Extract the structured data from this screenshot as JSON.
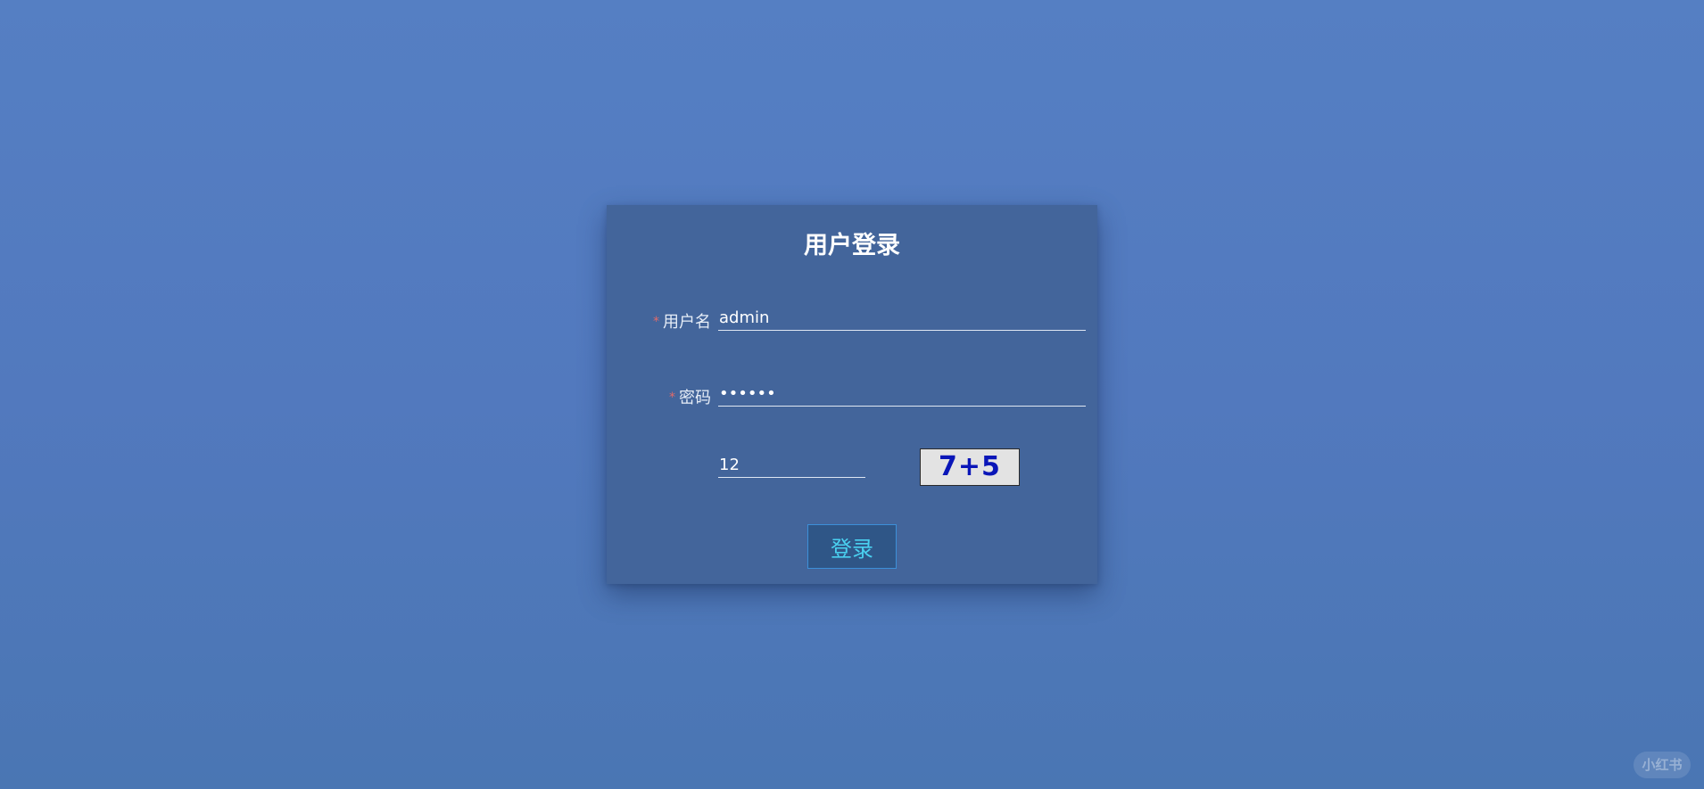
{
  "login": {
    "title": "用户登录",
    "username": {
      "required_mark": "*",
      "label": "用户名",
      "value": "admin"
    },
    "password": {
      "required_mark": "*",
      "label": "密码",
      "value": "••••••"
    },
    "captcha": {
      "input_value": "12",
      "image_text": "7+5"
    },
    "submit_label": "登录"
  },
  "watermark": {
    "text": "小红书"
  },
  "colors": {
    "background": "#557fc3",
    "card": "#43659b",
    "button_text": "#4ad0f0",
    "captcha_text": "#0a16b8",
    "required_mark": "#e06a6a"
  }
}
